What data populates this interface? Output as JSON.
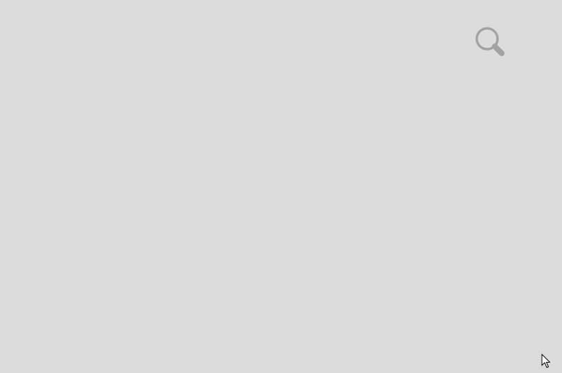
{
  "screen": {
    "background_color": "#dcdcdc"
  },
  "search": {
    "icon": "search-icon",
    "icon_color": "#a3a3a3"
  },
  "pointer": {
    "icon": "mouse-pointer-icon"
  }
}
